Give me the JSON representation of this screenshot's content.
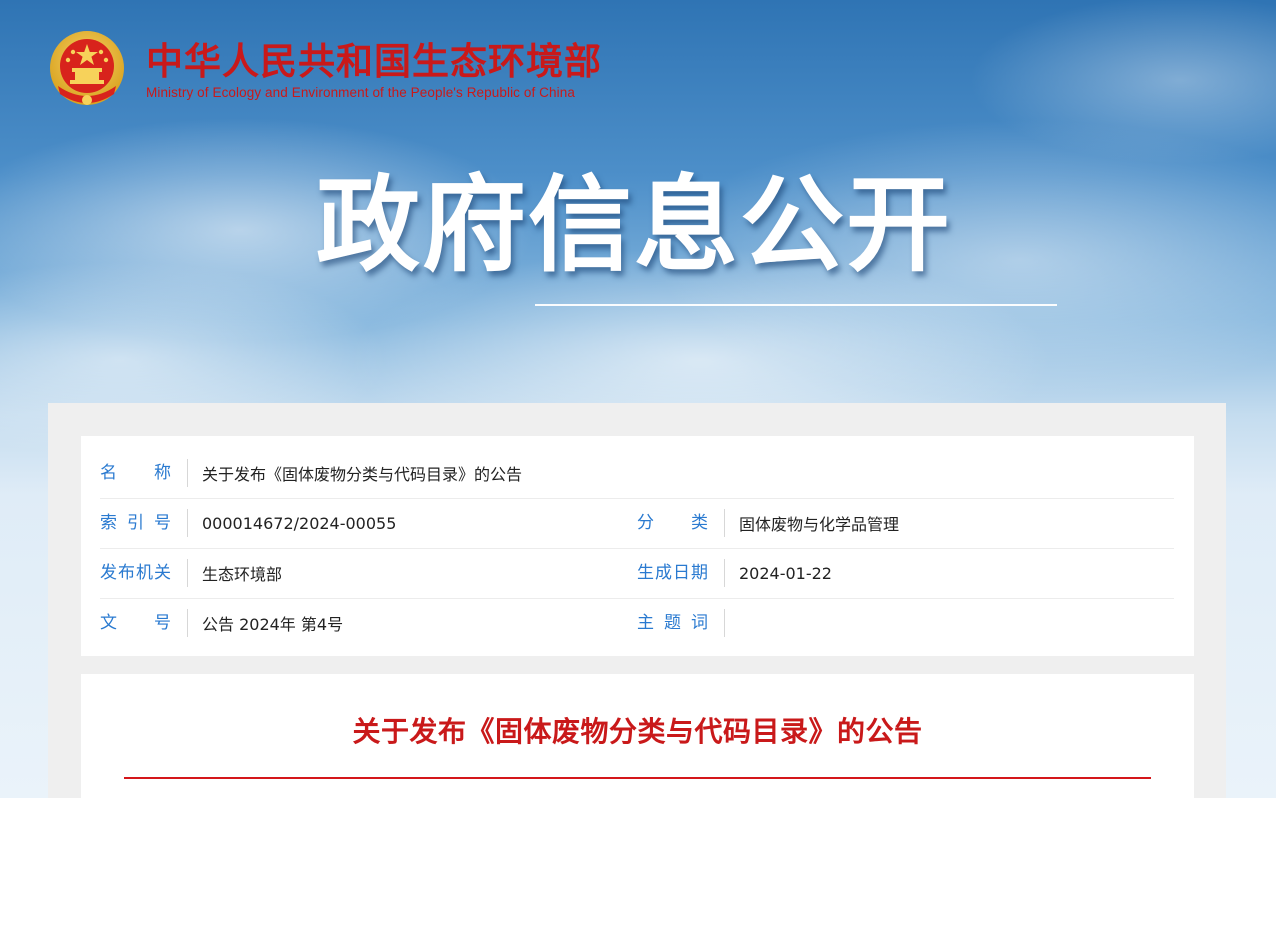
{
  "header": {
    "ministry_name_cn": "中华人民共和国生态环境部",
    "ministry_name_en": "Ministry of Ecology and Environment of the People's Republic of China",
    "banner_title": "政府信息公开"
  },
  "info": {
    "rows": [
      {
        "label": "名称",
        "value": "关于发布《固体废物分类与代码目录》的公告"
      },
      {
        "label": "索引号",
        "value": "000014672/2024-00055",
        "label2": "分类",
        "value2": "固体废物与化学品管理"
      },
      {
        "label": "发布机关",
        "value": "生态环境部",
        "label2": "生成日期",
        "value2": "2024-01-22"
      },
      {
        "label": "文号",
        "value": "公告 2024年 第4号",
        "label2": "主题词",
        "value2": ""
      }
    ]
  },
  "document": {
    "title": "关于发布《固体废物分类与代码目录》的公告"
  },
  "colors": {
    "brand_red": "#c9191a",
    "label_blue": "#2a7ad0"
  }
}
